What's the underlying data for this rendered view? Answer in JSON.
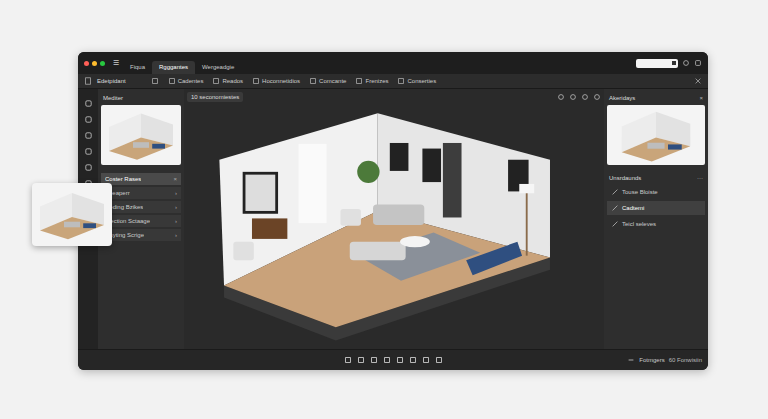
{
  "window": {
    "controls": [
      {
        "color": "#ff5f57"
      },
      {
        "color": "#febc2e"
      },
      {
        "color": "#28c840"
      }
    ]
  },
  "menu_icon": "☰",
  "tabs": [
    {
      "label": "Fiqua",
      "selected": false
    },
    {
      "label": "Rgggantes",
      "selected": true
    },
    {
      "label": "Wergeadgie",
      "selected": false
    }
  ],
  "toolbar": {
    "title": "Edetpidant",
    "items": [
      "Cadentes",
      "Reados",
      "Hoconnetidios",
      "Comcante",
      "Frenizes",
      "Conserties"
    ]
  },
  "left_panel": {
    "title": "Mediter",
    "items": [
      {
        "label": "Coster Rases",
        "selected": true,
        "trailing": "×"
      },
      {
        "label": "Seeaperr",
        "selected": false,
        "trailing": "›"
      },
      {
        "label": "Ceding Bzikes",
        "selected": false,
        "trailing": "›"
      },
      {
        "label": "Slection Sctaage",
        "selected": false,
        "trailing": "›"
      },
      {
        "label": "Dayting Scrige",
        "selected": false,
        "trailing": "›"
      }
    ]
  },
  "viewport": {
    "chip": "10 seconomiestes"
  },
  "right_panel": {
    "title": "Akeridays",
    "close": "×",
    "section": "Unsrdaunds",
    "more": "···",
    "items": [
      {
        "label": "Touse Bloiste",
        "selected": false
      },
      {
        "label": "Cadtemi",
        "selected": true
      },
      {
        "label": "Teicl seleves",
        "selected": false
      }
    ]
  },
  "status": {
    "label": "Fotmgers",
    "reading": "60 Fonwisiin"
  }
}
